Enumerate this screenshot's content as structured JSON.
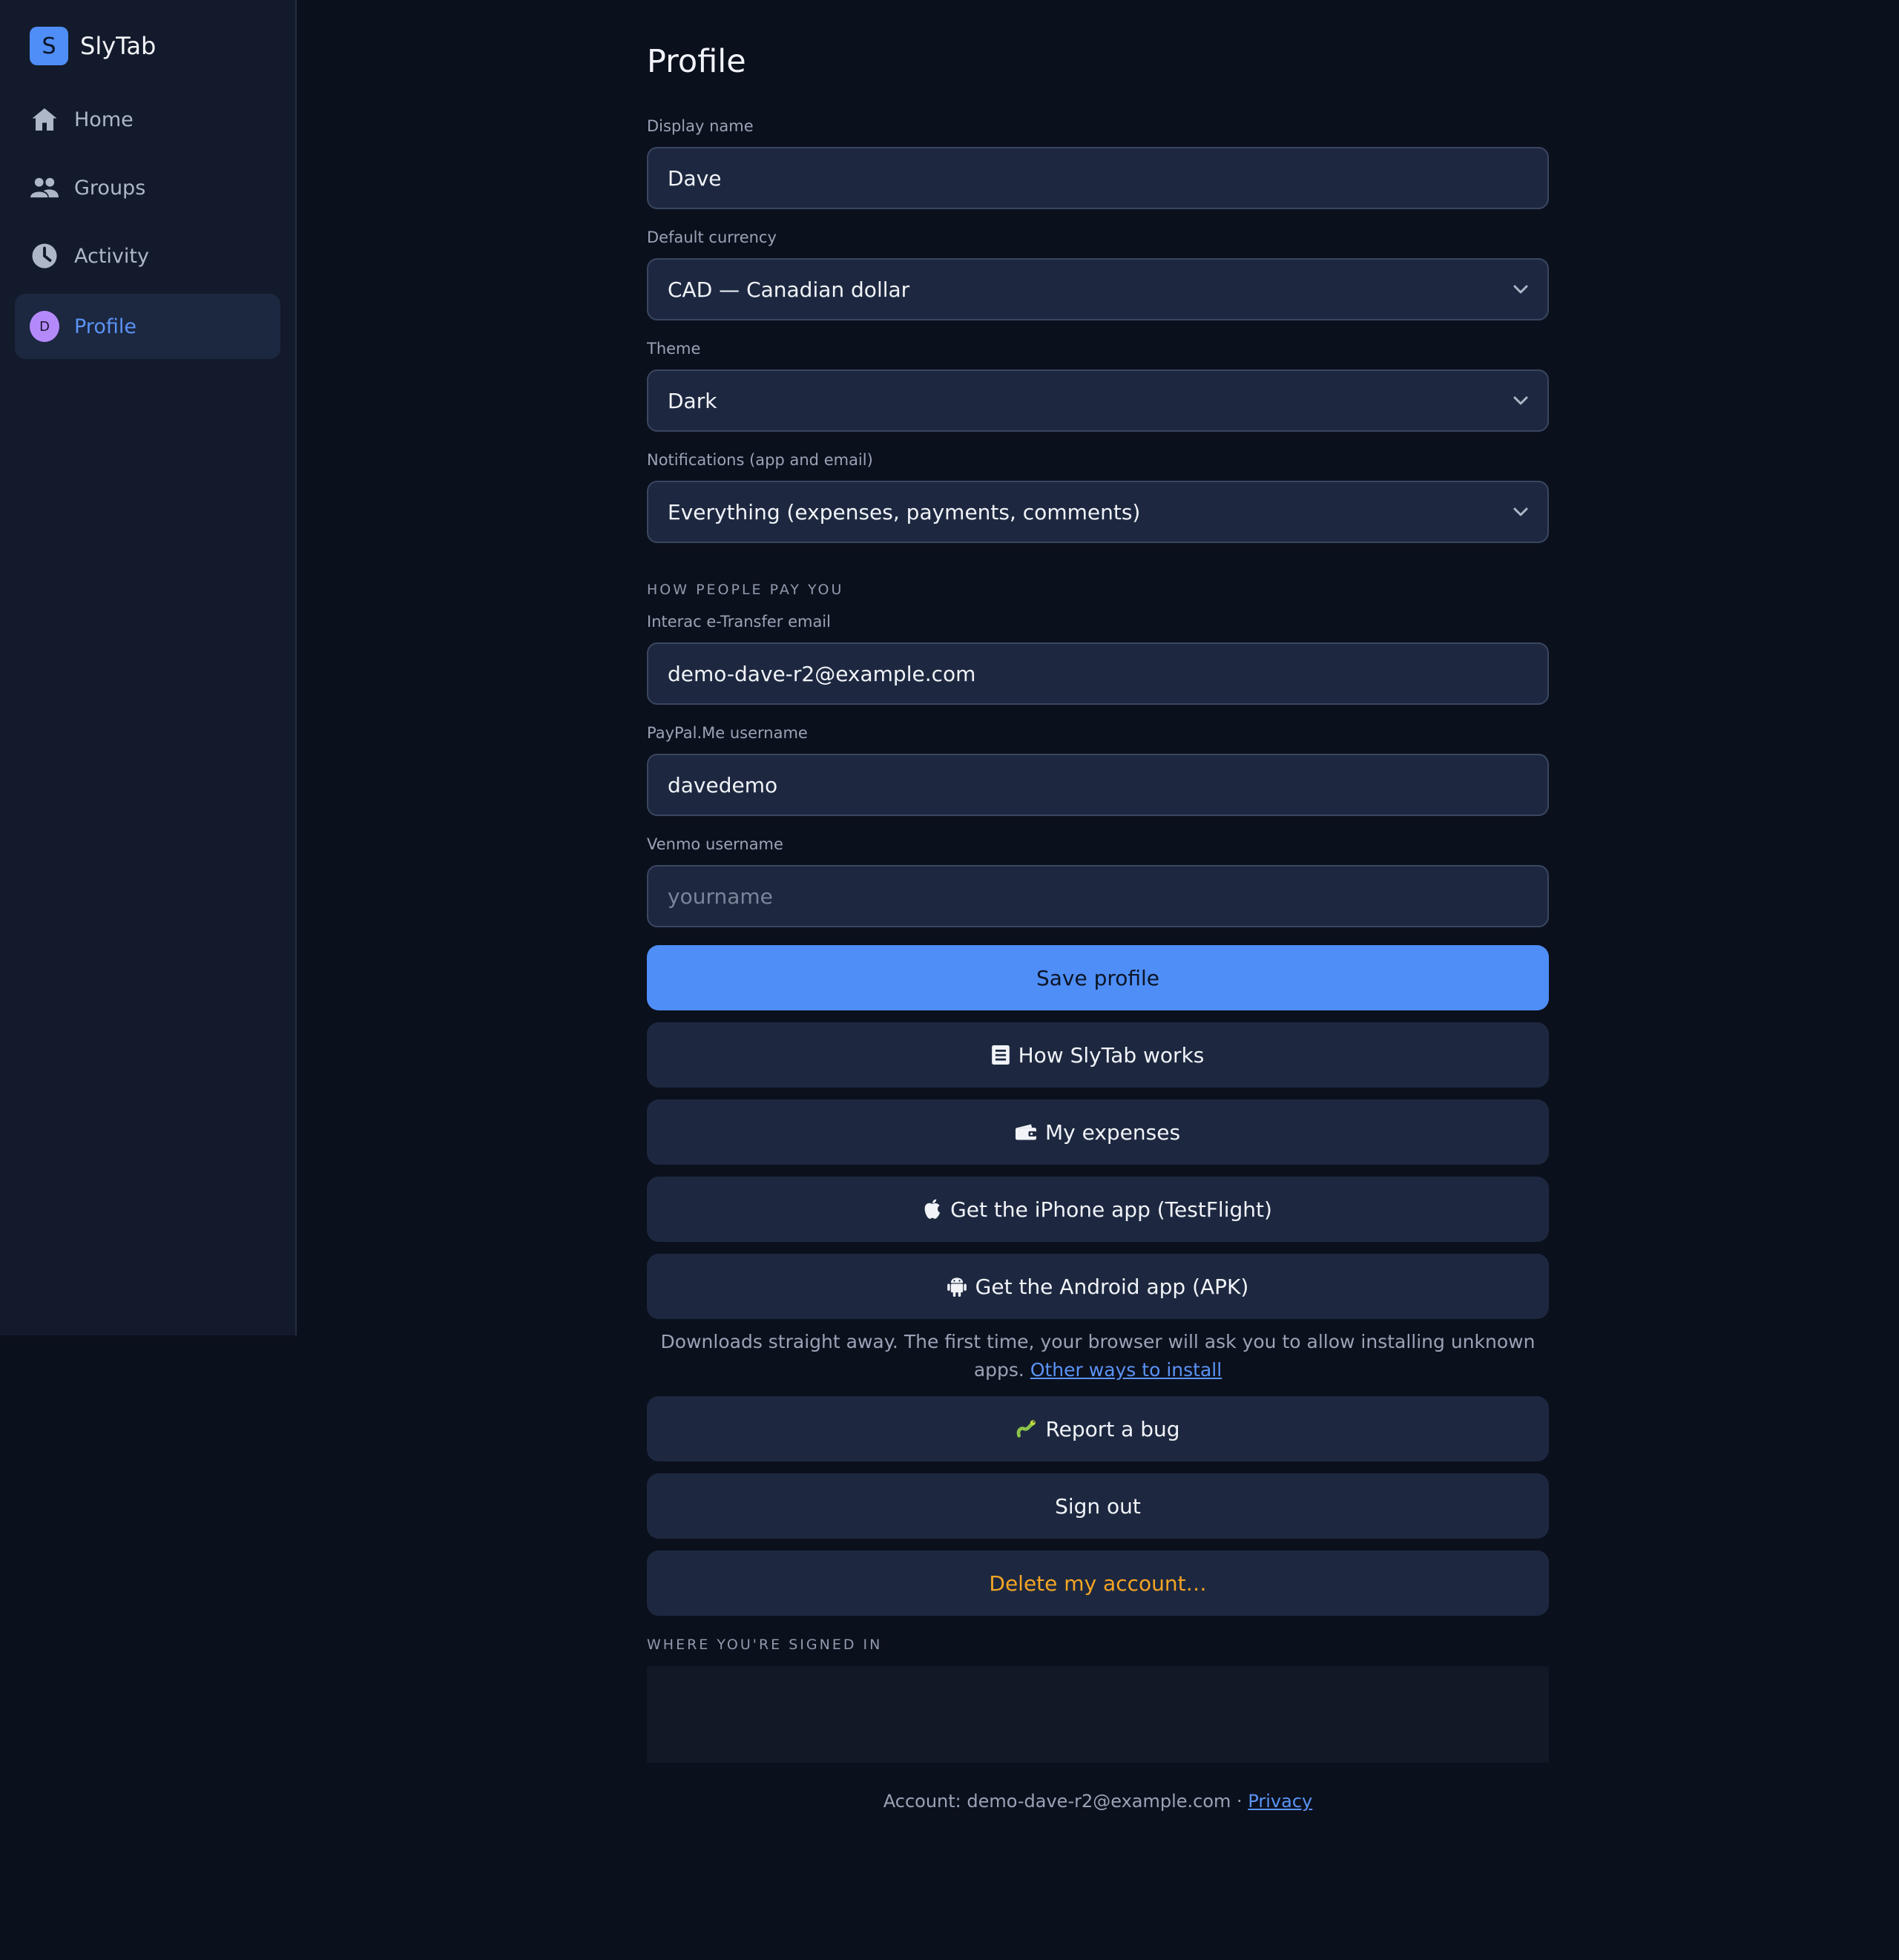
{
  "app": {
    "brand_letter": "S",
    "brand_name": "SlyTab"
  },
  "sidebar": {
    "items": [
      {
        "label": "Home",
        "icon": "home-icon"
      },
      {
        "label": "Groups",
        "icon": "people-icon"
      },
      {
        "label": "Activity",
        "icon": "clock-icon"
      },
      {
        "label": "Profile",
        "icon": "avatar",
        "avatar_letter": "D",
        "active": true
      }
    ]
  },
  "profile": {
    "title": "Profile",
    "display_name": {
      "label": "Display name",
      "value": "Dave"
    },
    "currency": {
      "label": "Default currency",
      "value": "CAD — Canadian dollar"
    },
    "theme": {
      "label": "Theme",
      "value": "Dark"
    },
    "notifications": {
      "label": "Notifications (app and email)",
      "value": "Everything (expenses, payments, comments)"
    },
    "pay_section": "HOW PEOPLE PAY YOU",
    "interac": {
      "label": "Interac e-Transfer email",
      "value": "demo-dave-r2@example.com"
    },
    "paypal": {
      "label": "PayPal.Me username",
      "value": "davedemo"
    },
    "venmo": {
      "label": "Venmo username",
      "value": "",
      "placeholder": "yourname"
    }
  },
  "actions": {
    "save": "Save profile",
    "how_it_works": "How SlyTab works",
    "my_expenses": "My expenses",
    "iphone_app": "Get the iPhone app (TestFlight)",
    "android_app": "Get the Android app (APK)",
    "android_help": "Downloads straight away. The first time, your browser will ask you to allow installing unknown apps.",
    "android_help_link": "Other ways to install",
    "report_bug": "Report a bug",
    "sign_out": "Sign out",
    "delete_account": "Delete my account…"
  },
  "sessions": {
    "heading": "WHERE YOU'RE SIGNED IN"
  },
  "footer": {
    "account_prefix": "Account: demo-dave-r2@example.com · ",
    "privacy": "Privacy"
  },
  "colors": {
    "background": "#0b101d",
    "sidebar": "#131a2b",
    "accent": "#4f8ef7",
    "field_bg": "#1d2840",
    "danger": "#f5a524",
    "avatar": "#b48afa"
  }
}
